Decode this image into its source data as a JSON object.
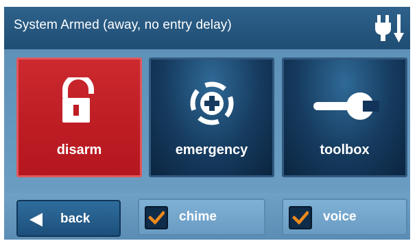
{
  "header": {
    "title": "System Armed (away, no entry delay)",
    "power_icon": "ac-power-plug-icon"
  },
  "tiles": [
    {
      "id": "disarm",
      "label": "disarm",
      "icon": "padlock-open-icon",
      "color": "#c4242a"
    },
    {
      "id": "emergency",
      "label": "emergency",
      "icon": "emergency-plus-icon",
      "color": "#163b5f"
    },
    {
      "id": "toolbox",
      "label": "toolbox",
      "icon": "wrench-icon",
      "color": "#163b5f"
    }
  ],
  "footer": {
    "back_label": "back",
    "back_icon": "left-arrow-icon",
    "chime": {
      "label": "chime",
      "checked": true
    },
    "voice": {
      "label": "voice",
      "checked": true
    },
    "check_color": "#f08a1c"
  }
}
